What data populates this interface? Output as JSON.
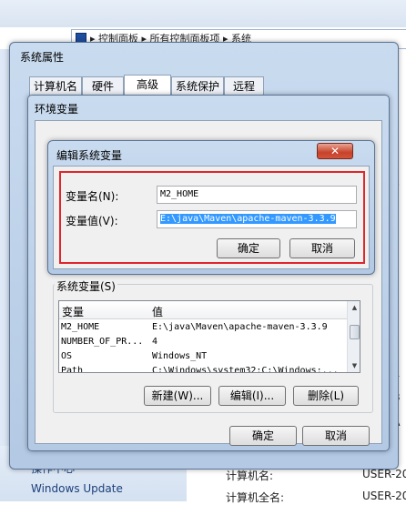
{
  "explorer": {
    "breadcrumb": "▸ 控制面板 ▸ 所有控制面板项 ▸ 系统",
    "left_links": [
      "操作中心",
      "Windows Update"
    ],
    "info": {
      "computer_name_label": "计算机名:",
      "computer_name_value": "USER-20",
      "computer_fullname_label": "计算机全名:",
      "computer_fullname_value": "USER-20"
    },
    "right_fragments": [
      "o",
      "(",
      "4",
      "B",
      "A"
    ]
  },
  "system_properties": {
    "title": "系统属性",
    "tabs": [
      "计算机名",
      "硬件",
      "高级",
      "系统保护",
      "远程"
    ],
    "active_tab_index": 2
  },
  "env_vars": {
    "title": "环境变量",
    "system_vars": {
      "legend": "系统变量(S)",
      "columns": [
        "变量",
        "值"
      ],
      "rows": [
        {
          "name": "M2_HOME",
          "value": "E:\\java\\Maven\\apache-maven-3.3.9"
        },
        {
          "name": "NUMBER_OF_PR...",
          "value": "4"
        },
        {
          "name": "OS",
          "value": "Windows_NT"
        },
        {
          "name": "Path",
          "value": "C:\\Windows\\system32;C:\\Windows;..."
        }
      ],
      "buttons": [
        "新建(W)...",
        "编辑(I)...",
        "删除(L)"
      ]
    },
    "ok": "确定",
    "cancel": "取消"
  },
  "edit_dialog": {
    "title": "编辑系统变量",
    "close_glyph": "✕",
    "name_label": "变量名(N):",
    "value_label": "变量值(V):",
    "name_value": "M2_HOME",
    "value_value": "E:\\java\\Maven\\apache-maven-3.3.9",
    "ok": "确定",
    "cancel": "取消",
    "highlight_color": "#e0262a"
  }
}
